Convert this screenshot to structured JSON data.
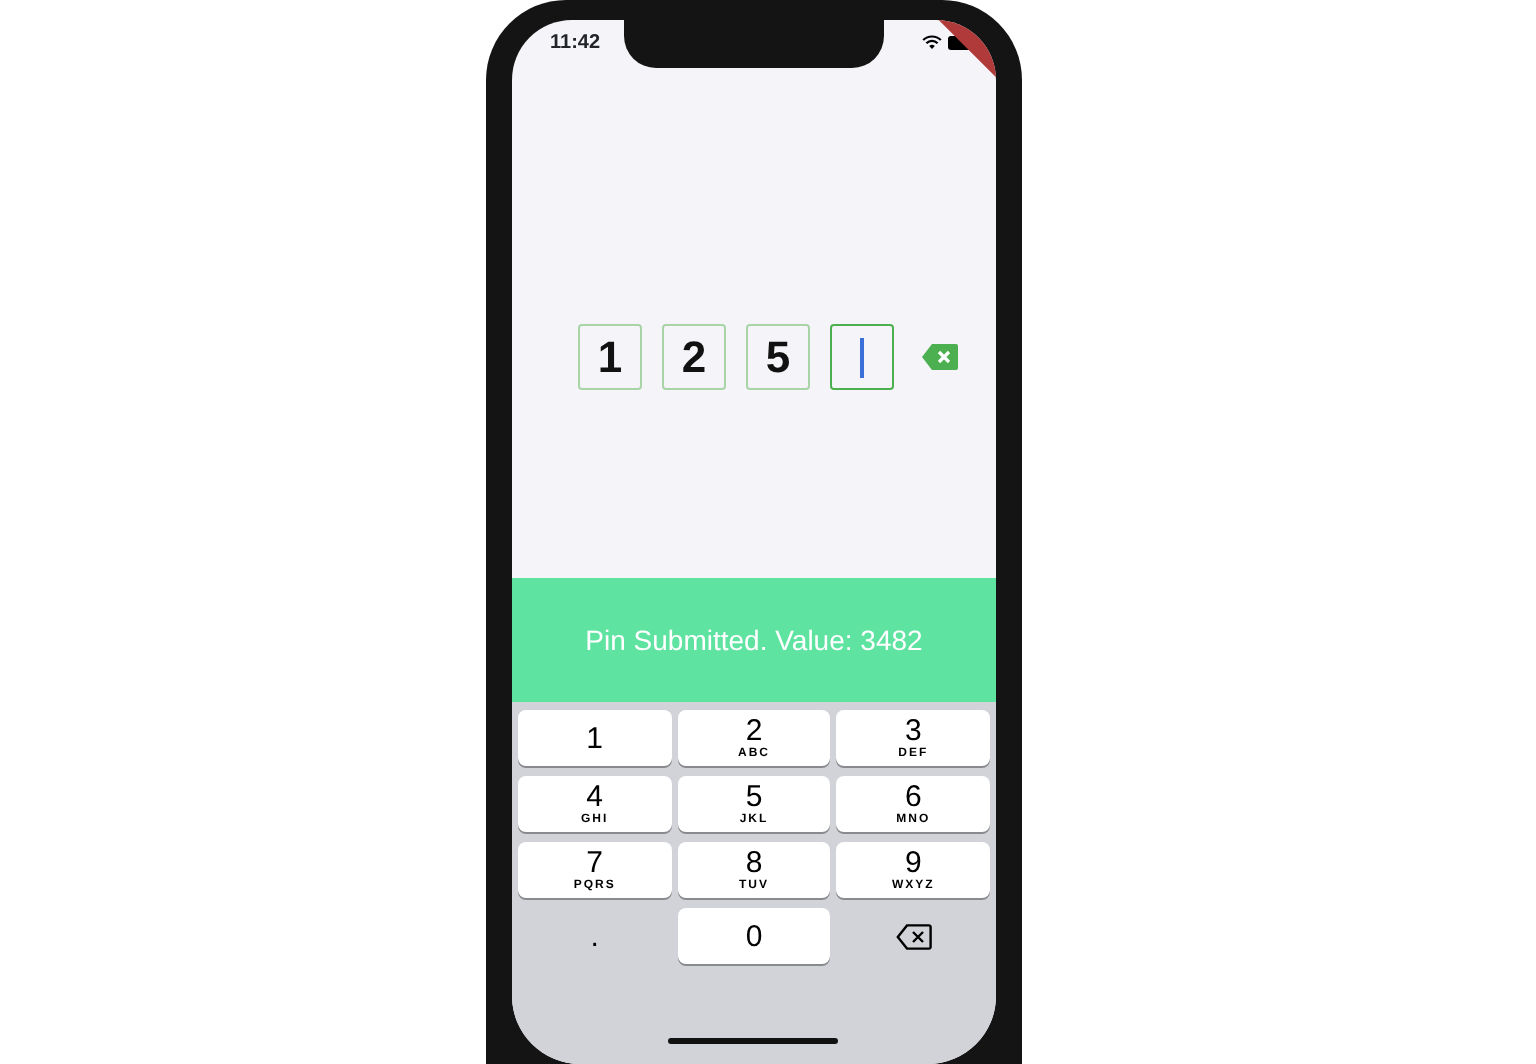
{
  "status_bar": {
    "time": "11:42"
  },
  "pin_fields": [
    {
      "value": "1",
      "focused": false
    },
    {
      "value": "2",
      "focused": false
    },
    {
      "value": "5",
      "focused": false
    },
    {
      "focused": true
    }
  ],
  "snackbar": {
    "text": "Pin Submitted. Value: 3482"
  },
  "keypad": [
    {
      "kind": "digit",
      "digit": "1"
    },
    {
      "kind": "digit",
      "digit": "2",
      "letters": "ABC"
    },
    {
      "kind": "digit",
      "digit": "3",
      "letters": "DEF"
    },
    {
      "kind": "digit",
      "digit": "4",
      "letters": "GHI"
    },
    {
      "kind": "digit",
      "digit": "5",
      "letters": "JKL"
    },
    {
      "kind": "digit",
      "digit": "6",
      "letters": "MNO"
    },
    {
      "kind": "digit",
      "digit": "7",
      "letters": "PQRS"
    },
    {
      "kind": "digit",
      "digit": "8",
      "letters": "TUV"
    },
    {
      "kind": "digit",
      "digit": "9",
      "letters": "WXYZ"
    },
    {
      "kind": "dot",
      "digit": "."
    },
    {
      "kind": "digit",
      "digit": "0"
    },
    {
      "kind": "backspace"
    }
  ]
}
